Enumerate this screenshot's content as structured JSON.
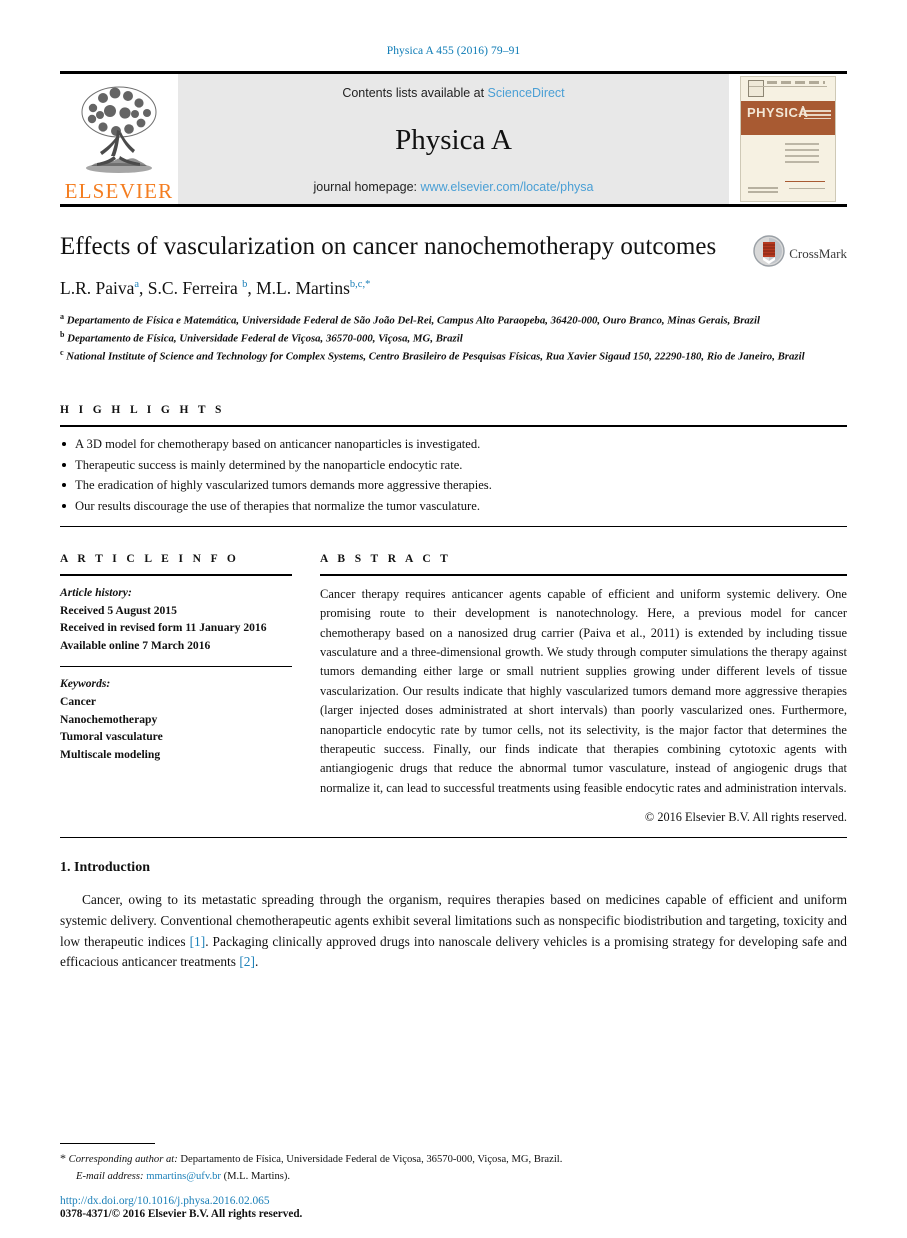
{
  "running_head": "Physica A 455 (2016) 79–91",
  "masthead": {
    "publisher_wordmark": "ELSEVIER",
    "contents_prefix": "Contents lists available at ",
    "sciencedirect": "ScienceDirect",
    "journal_title": "Physica A",
    "homepage_prefix": "journal homepage: ",
    "homepage_url": "www.elsevier.com/locate/physa",
    "cover": {
      "name": "PHYSICA",
      "letter": "A",
      "subtitle": "STATISTICAL MECHANICS AND ITS APPLICATIONS"
    }
  },
  "article": {
    "title": "Effects of vascularization on cancer nanochemotherapy outcomes",
    "crossmark_label": "CrossMark",
    "authors": [
      {
        "name": "L.R. Paiva",
        "sup": "a"
      },
      {
        "name": "S.C. Ferreira",
        "sup": "b"
      },
      {
        "name": "M.L. Martins",
        "sup": "b,c,*"
      }
    ],
    "affiliations": [
      {
        "marker": "a",
        "text": "Departamento de Física e Matemática, Universidade Federal de São João Del-Rei, Campus Alto Paraopeba, 36420-000, Ouro Branco, Minas Gerais, Brazil"
      },
      {
        "marker": "b",
        "text": "Departamento de Física, Universidade Federal de Viçosa, 36570-000, Viçosa, MG, Brazil"
      },
      {
        "marker": "c",
        "text": "National Institute of Science and Technology for Complex Systems, Centro Brasileiro de Pesquisas Físicas, Rua Xavier Sigaud 150, 22290-180, Rio de Janeiro, Brazil"
      }
    ]
  },
  "highlights": {
    "heading": "H I G H L I G H T S",
    "items": [
      "A 3D model for chemotherapy based on  anticancer nanoparticles is investigated.",
      "Therapeutic success is mainly determined by the nanoparticle endocytic rate.",
      "The eradication of highly vascularized tumors demands more aggressive therapies.",
      "Our results discourage the use of therapies that normalize the tumor vasculature."
    ]
  },
  "article_info": {
    "heading": "A R T I C L E    I N F O",
    "history_label": "Article history:",
    "history": [
      "Received 5 August 2015",
      "Received in revised form 11 January 2016",
      "Available online 7 March 2016"
    ],
    "keywords_label": "Keywords:",
    "keywords": [
      "Cancer",
      "Nanochemotherapy",
      "Tumoral vasculature",
      "Multiscale modeling"
    ]
  },
  "abstract": {
    "heading": "A B S T R A C T",
    "text": "Cancer therapy requires anticancer agents capable of efficient and uniform systemic delivery. One promising route to their development is nanotechnology. Here, a previous model for cancer chemotherapy based on a nanosized drug carrier (Paiva et al., 2011) is extended by including tissue vasculature and a three-dimensional growth. We study through computer simulations the therapy against tumors demanding either large or small nutrient supplies growing under different levels of tissue vascularization. Our results indicate that highly vascularized tumors demand more aggressive therapies (larger injected doses administrated at short intervals) than poorly vascularized ones. Furthermore, nanoparticle endocytic rate by tumor cells, not its selectivity, is the major factor that determines the therapeutic success. Finally, our finds indicate that therapies combining cytotoxic agents with antiangiogenic drugs that reduce the abnormal tumor vasculature, instead of angiogenic drugs that normalize it, can lead to successful treatments using feasible endocytic rates and administration intervals.",
    "copyright": "© 2016 Elsevier B.V. All rights reserved."
  },
  "body": {
    "section_number": "1.",
    "section_title": "Introduction",
    "paragraph_part1": "Cancer, owing to its metastatic spreading through the organism, requires therapies based on medicines capable of efficient and uniform systemic delivery. Conventional chemotherapeutic agents exhibit several limitations such as nonspecific biodistribution and targeting, toxicity and low therapeutic indices ",
    "cite1": "[1]",
    "paragraph_part2": ". Packaging clinically approved drugs into nanoscale delivery vehicles is a promising strategy for developing safe and efficacious anticancer treatments ",
    "cite2": "[2]",
    "paragraph_part3": "."
  },
  "footer": {
    "star": "*",
    "corresponding_label": "Corresponding author at:",
    "corresponding_text": " Departamento de Física, Universidade Federal de Viçosa, 36570-000, Viçosa, MG, Brazil.",
    "email_label": "E-mail address:",
    "email": "mmartins@ufv.br",
    "email_owner": "(M.L. Martins).",
    "doi": "http://dx.doi.org/10.1016/j.physa.2016.02.065",
    "issn": "0378-4371/© 2016 Elsevier B.V. All rights reserved."
  },
  "colors": {
    "link_blue": "#1a7fb8",
    "header_blue": "#0b7ab5",
    "sciencedirect_blue": "#4a9fd5",
    "elsevier_orange": "#f47d20",
    "banner_gray": "#e8e8e8"
  }
}
